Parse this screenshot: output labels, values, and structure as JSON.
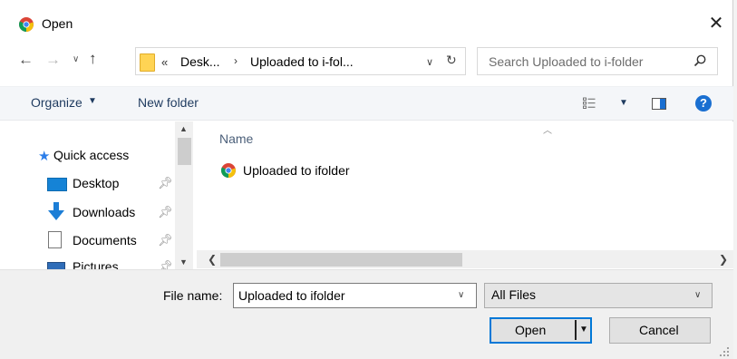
{
  "window": {
    "title": "Open",
    "close_glyph": "✕"
  },
  "address": {
    "overflow_glyph": "«",
    "crumbs": [
      "Desk...",
      "Uploaded to i-fol..."
    ],
    "separator": "›"
  },
  "search": {
    "placeholder": "Search Uploaded to i-folder"
  },
  "toolbar": {
    "organize_label": "Organize",
    "new_folder_label": "New folder",
    "help_glyph": "?"
  },
  "nav_pane": {
    "items": [
      {
        "label": "Quick access",
        "icon": "star-icon"
      },
      {
        "label": "Desktop",
        "icon": "desktop-icon",
        "pinned": true
      },
      {
        "label": "Downloads",
        "icon": "downloads-icon",
        "pinned": true
      },
      {
        "label": "Documents",
        "icon": "documents-icon",
        "pinned": true
      },
      {
        "label": "Pictures",
        "icon": "pictures-icon",
        "pinned": true
      }
    ]
  },
  "file_list": {
    "columns": [
      "Name"
    ],
    "files": [
      {
        "name": "Uploaded to ifolder",
        "icon": "chrome-icon"
      }
    ]
  },
  "bottom": {
    "filename_label": "File name:",
    "filename_value": "Uploaded to ifolder",
    "filter_value": "All Files",
    "open_label": "Open",
    "cancel_label": "Cancel"
  },
  "colors": {
    "accent": "#0078d7",
    "toolbar_bg": "#f4f6f9",
    "help_icon": "#1a6fd1",
    "folder_icon": "#ffd454"
  }
}
